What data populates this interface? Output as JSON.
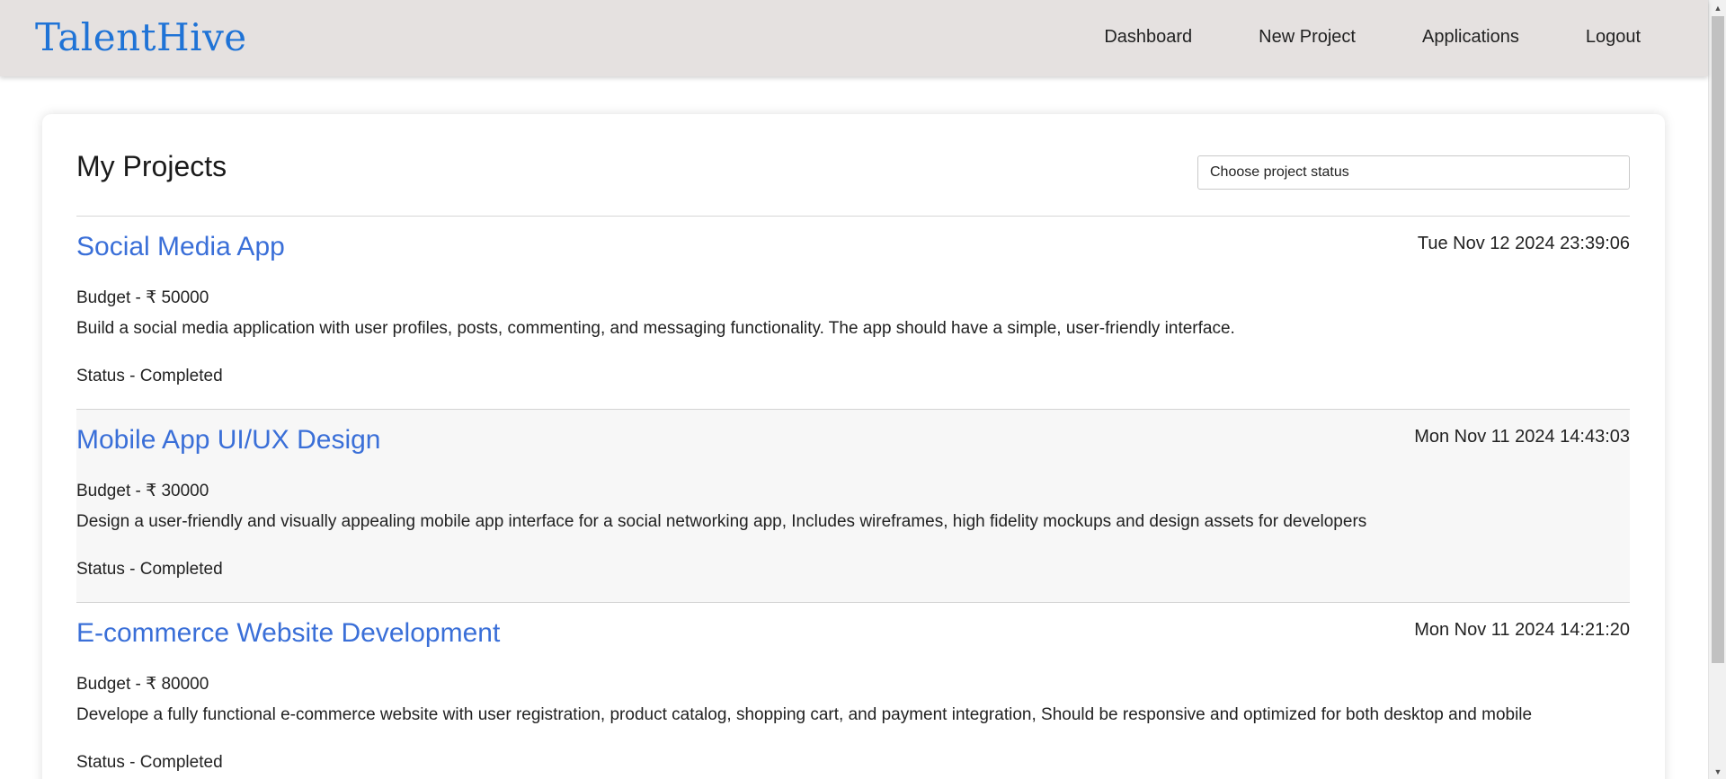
{
  "header": {
    "brand": "TalentHive",
    "nav": [
      {
        "label": "Dashboard"
      },
      {
        "label": "New Project"
      },
      {
        "label": "Applications"
      },
      {
        "label": "Logout"
      }
    ]
  },
  "main": {
    "title": "My Projects",
    "status_filter": {
      "placeholder": "Choose project status"
    },
    "projects": [
      {
        "title": "Social Media App",
        "date": "Tue Nov 12 2024 23:39:06",
        "budget": "Budget - ₹ 50000",
        "description": "Build a social media application with user profiles, posts, commenting, and messaging functionality. The app should have a simple, user-friendly interface.",
        "status": "Status - Completed"
      },
      {
        "title": "Mobile App UI/UX Design",
        "date": "Mon Nov 11 2024 14:43:03",
        "budget": "Budget - ₹ 30000",
        "description": "Design a user-friendly and visually appealing mobile app interface for a social networking app, Includes wireframes, high fidelity mockups and design assets for developers",
        "status": "Status - Completed"
      },
      {
        "title": "E-commerce Website Development",
        "date": "Mon Nov 11 2024 14:21:20",
        "budget": "Budget - ₹ 80000",
        "description": "Develope a fully functional e-commerce website with user registration, product catalog, shopping cart, and payment integration, Should be responsive and optimized for both desktop and mobile",
        "status": "Status - Completed"
      }
    ]
  },
  "colors": {
    "navbar_bg": "#e5e1e0",
    "brand": "#1f73d6",
    "project_title": "#3a6fd8",
    "row_alt_bg": "#f7f7f7"
  },
  "icons": {
    "scroll_up": "triangle-up",
    "scroll_down": "triangle-down"
  }
}
